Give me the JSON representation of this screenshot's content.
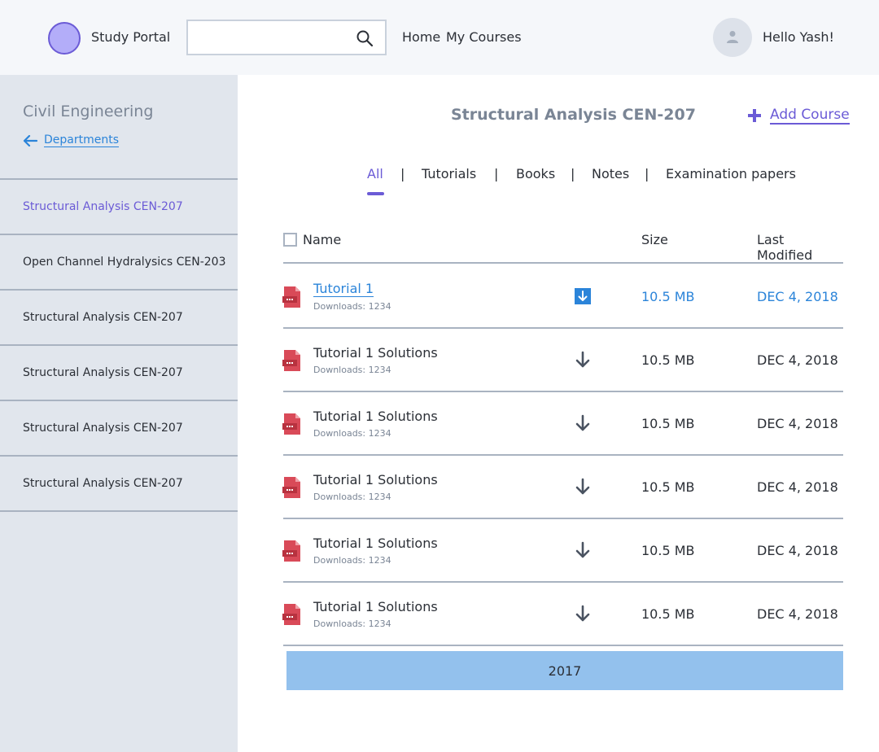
{
  "app": {
    "title": "Study Portal"
  },
  "header": {
    "search": {
      "value": "",
      "placeholder": ""
    },
    "nav": [
      {
        "label": "Home"
      },
      {
        "label": "My Courses"
      }
    ],
    "greeting": "Hello Yash!"
  },
  "sidebar": {
    "department": "Civil Engineering",
    "back_label": "Departments",
    "items": [
      {
        "label": "Structural Analysis CEN-207",
        "active": true
      },
      {
        "label": "Open Channel Hydralysics CEN-203"
      },
      {
        "label": "Structural Analysis CEN-207"
      },
      {
        "label": "Structural Analysis CEN-207"
      },
      {
        "label": "Structural Analysis CEN-207"
      },
      {
        "label": "Structural Analysis CEN-207"
      }
    ]
  },
  "main": {
    "course_title": "Structural Analysis CEN-207",
    "add_course_label": "Add Course",
    "tabs": [
      {
        "label": "All",
        "active": true
      },
      {
        "label": "Tutorials"
      },
      {
        "label": "Books"
      },
      {
        "label": "Notes"
      },
      {
        "label": "Examination papers"
      }
    ],
    "tab_separator": "|",
    "table": {
      "columns": {
        "name": "Name",
        "size": "Size",
        "modified": "Last Modified"
      },
      "rows": [
        {
          "name": "Tutorial 1",
          "downloads": "Downloads: 1234",
          "size": "10.5 MB",
          "modified": "DEC 4, 2018",
          "highlighted": true
        },
        {
          "name": "Tutorial 1 Solutions",
          "downloads": "Downloads: 1234",
          "size": "10.5 MB",
          "modified": "DEC 4, 2018"
        },
        {
          "name": "Tutorial 1 Solutions",
          "downloads": "Downloads: 1234",
          "size": "10.5 MB",
          "modified": "DEC 4, 2018"
        },
        {
          "name": "Tutorial 1 Solutions",
          "downloads": "Downloads: 1234",
          "size": "10.5 MB",
          "modified": "DEC 4, 2018"
        },
        {
          "name": "Tutorial 1 Solutions",
          "downloads": "Downloads: 1234",
          "size": "10.5 MB",
          "modified": "DEC 4, 2018"
        },
        {
          "name": "Tutorial 1 Solutions",
          "downloads": "Downloads: 1234",
          "size": "10.5 MB",
          "modified": "DEC 4, 2018"
        }
      ]
    },
    "year_label": "2017"
  },
  "icons": {
    "logo": "logo-circle",
    "search": "search-icon",
    "avatar": "user-icon",
    "back": "arrow-left-icon",
    "add": "plus-icon",
    "file": "pdf-file-icon",
    "download": "download-arrow-icon"
  },
  "colors": {
    "accent": "#6b5bd6",
    "link": "#2b84d9",
    "pdf": "#d94a58",
    "year_bar": "#93c1ed",
    "sidebar_bg": "#e1e6ed",
    "header_bg": "#f5f7fa"
  }
}
